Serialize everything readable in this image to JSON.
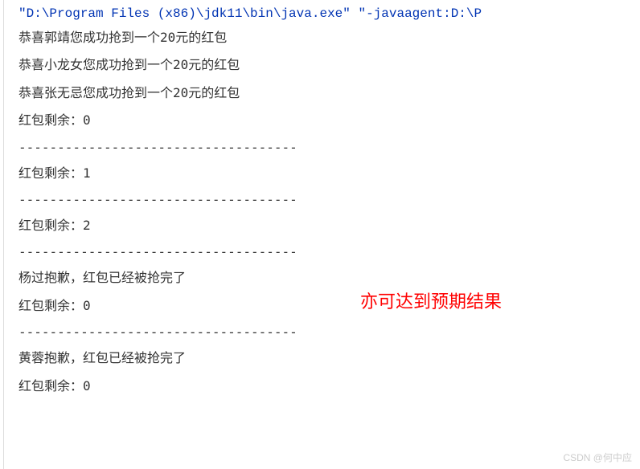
{
  "command": "\"D:\\Program Files (x86)\\jdk11\\bin\\java.exe\" \"-javaagent:D:\\P",
  "lines": {
    "success1": "恭喜郭靖您成功抢到一个20元的红包",
    "success2": "恭喜小龙女您成功抢到一个20元的红包",
    "success3": "恭喜张无忌您成功抢到一个20元的红包",
    "remain0a": "红包剩余：0",
    "sep": "------------------------------------",
    "remain1": "红包剩余：1",
    "remain2": "红包剩余：2",
    "fail1": "杨过抱歉，红包已经被抢完了",
    "remain0b": "红包剩余：0",
    "fail2": "黄蓉抱歉，红包已经被抢完了",
    "remain0c": "红包剩余：0"
  },
  "annotation": "亦可达到预期结果",
  "watermark": "CSDN @何中应"
}
